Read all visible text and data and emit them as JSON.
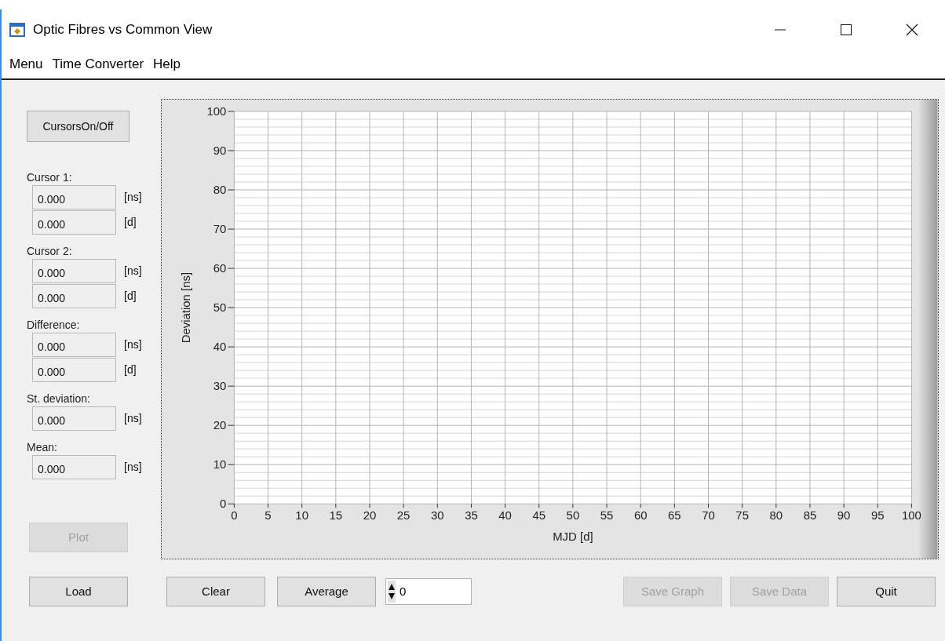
{
  "window": {
    "title": "Optic Fibres vs Common View"
  },
  "menu": [
    "Menu",
    "Time Converter",
    "Help"
  ],
  "cursors_button": {
    "label": "CursorsOn/Off"
  },
  "readouts": [
    {
      "label": "Cursor 1:",
      "fields": [
        {
          "value": "0.000",
          "unit": "[ns]"
        },
        {
          "value": "0.000",
          "unit": "[d]"
        }
      ]
    },
    {
      "label": "Cursor 2:",
      "fields": [
        {
          "value": "0.000",
          "unit": "[ns]"
        },
        {
          "value": "0.000",
          "unit": "[d]"
        }
      ]
    },
    {
      "label": "Difference:",
      "fields": [
        {
          "value": "0.000",
          "unit": "[ns]"
        },
        {
          "value": "0.000",
          "unit": "[d]"
        }
      ]
    },
    {
      "label": "St. deviation:",
      "fields": [
        {
          "value": "0.000",
          "unit": "[ns]"
        }
      ]
    },
    {
      "label": "Mean:",
      "fields": [
        {
          "value": "0.000",
          "unit": "[ns]"
        }
      ]
    }
  ],
  "plot_button": {
    "label": "Plot",
    "disabled": true
  },
  "chart": {
    "chart_data": {
      "type": "line",
      "grid": true,
      "xlabel": "MJD [d]",
      "ylabel": "Deviation [ns]",
      "xlim": [
        0,
        100
      ],
      "ylim": [
        0,
        100
      ],
      "xticks": [
        0,
        5,
        10,
        15,
        20,
        25,
        30,
        35,
        40,
        45,
        50,
        55,
        60,
        65,
        70,
        75,
        80,
        85,
        90,
        95,
        100
      ],
      "yticks": [
        0,
        10,
        20,
        30,
        40,
        50,
        60,
        70,
        80,
        90,
        100
      ]
    }
  },
  "left_buttons": [
    {
      "label": "Load",
      "disabled": false
    },
    {
      "label": "Clear",
      "disabled": false
    },
    {
      "label": "Average",
      "disabled": false
    }
  ],
  "spinner": {
    "value": "0"
  },
  "right_buttons": [
    {
      "label": "Save Graph",
      "disabled": true
    },
    {
      "label": "Save Data",
      "disabled": true
    },
    {
      "label": "Quit",
      "disabled": false
    }
  ]
}
